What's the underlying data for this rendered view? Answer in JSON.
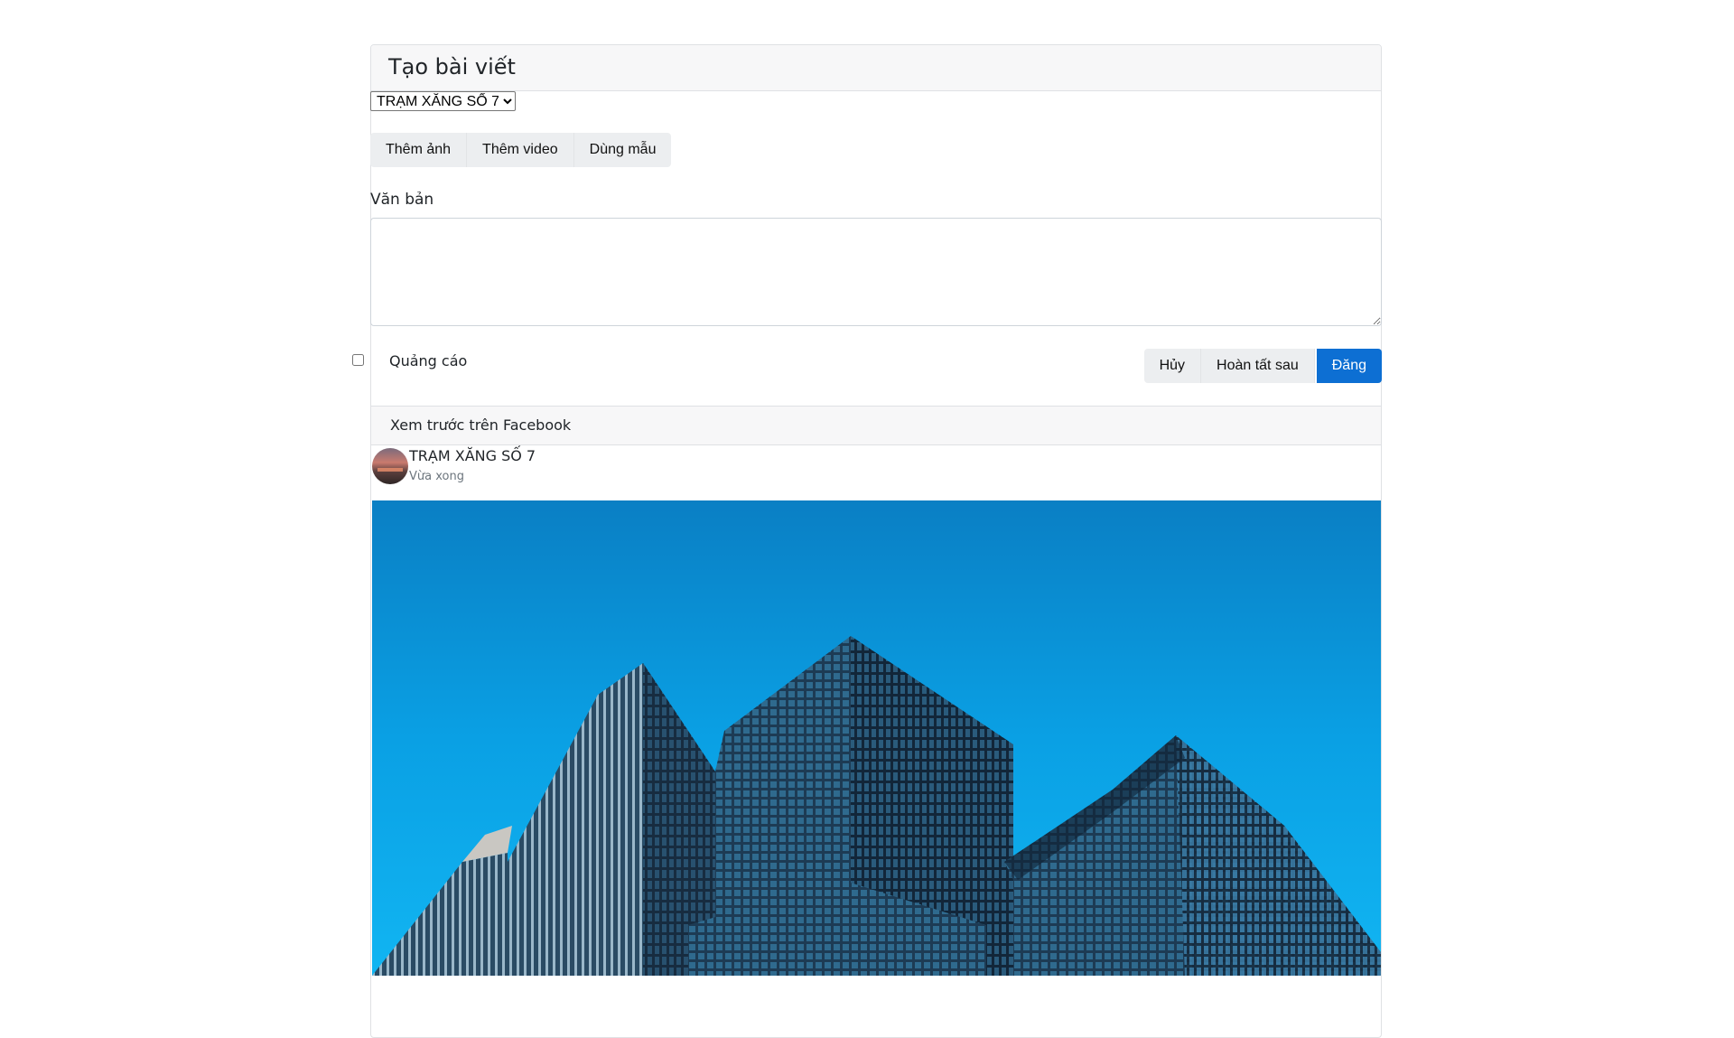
{
  "form": {
    "title": "Tạo bài viết",
    "page_select": {
      "selected": "TRẠM XĂNG SỐ 7"
    },
    "media_buttons": [
      "Thêm ảnh",
      "Thêm video",
      "Dùng mẫu"
    ],
    "text_label": "Văn bản",
    "text_value": "",
    "ad_checkbox_label": "Quảng cáo",
    "ad_checked": false,
    "actions": {
      "cancel": "Hủy",
      "later": "Hoàn tất sau",
      "post": "Đăng"
    }
  },
  "preview": {
    "header": "Xem trước trên Facebook",
    "page_name": "TRẠM XĂNG SỐ 7",
    "time": "Vừa xong"
  },
  "colors": {
    "primary": "#0d6fd3",
    "sky": "#0a8fd6"
  },
  "icons": {
    "dropdown": "chevron-down-icon"
  }
}
